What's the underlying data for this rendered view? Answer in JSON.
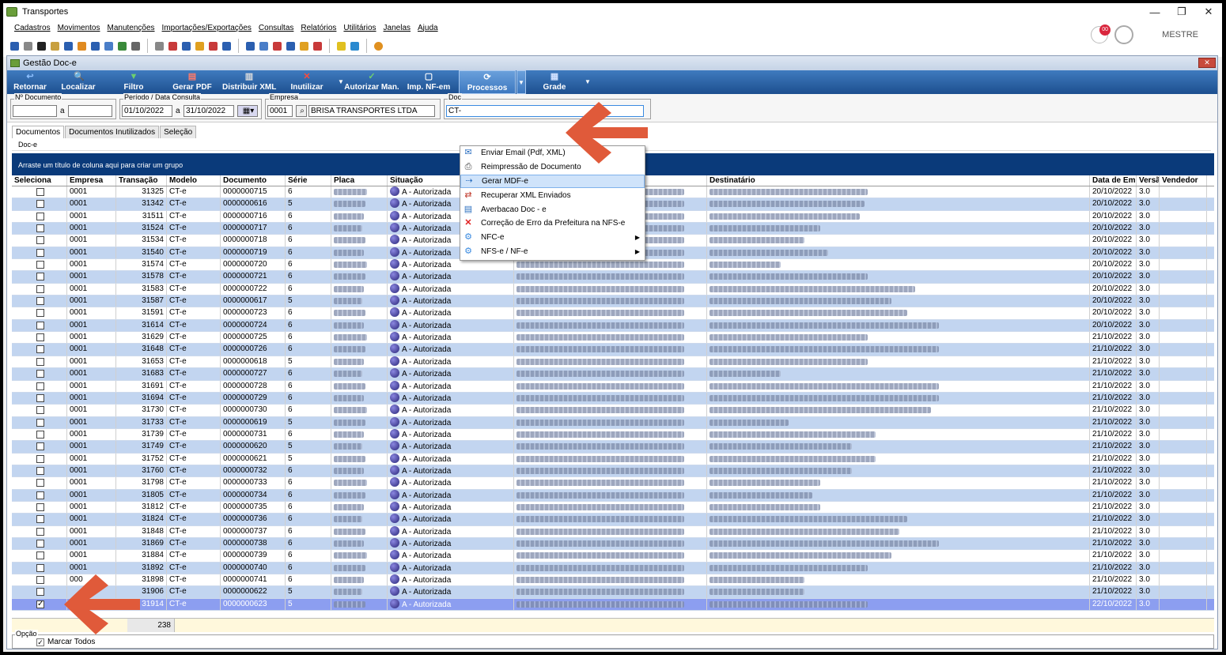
{
  "window": {
    "title": "Transportes",
    "controls": [
      "—",
      "❐",
      "✕"
    ]
  },
  "menu": [
    "Cadastros",
    "Movimentos",
    "Manutenções",
    "Importações/Exportações",
    "Consultas",
    "Relatórios",
    "Utilitários",
    "Janelas",
    "Ajuda"
  ],
  "user": {
    "name": "MESTRE",
    "notification_count": "00"
  },
  "child": {
    "title": "Gestão Doc-e",
    "close": "✕"
  },
  "ribbon": [
    {
      "label": "Retornar",
      "icon": "↩"
    },
    {
      "label": "Localizar",
      "icon": "🔍"
    },
    {
      "label": "Filtro",
      "icon": "▼"
    },
    {
      "label": "Gerar PDF",
      "icon": "▤"
    },
    {
      "label": "Distribuir XML",
      "icon": "▥"
    },
    {
      "label": "Inutilizar",
      "icon": "✕"
    },
    {
      "label": "Autorizar Man.",
      "icon": "✓"
    },
    {
      "label": "Imp. NF-em",
      "icon": "▢"
    },
    {
      "label": "Processos",
      "icon": "⟳"
    },
    {
      "label": "Grade",
      "icon": "▦"
    }
  ],
  "filters": {
    "doc_legend": "Nº Documento",
    "doc_from": "",
    "doc_sep": "a",
    "doc_to": "",
    "period_legend": "Período / Data Consulta",
    "period_from": "01/10/2022",
    "period_sep": "a",
    "period_to": "31/10/2022",
    "empresa_legend": "Empresa",
    "empresa_code": "0001",
    "empresa_name": "BRISA TRANSPORTES LTDA",
    "doc_type_legend": "Doc",
    "doc_type_value": "CT-"
  },
  "tabs": [
    "Documentos",
    "Documentos Inutilizados",
    "Seleção"
  ],
  "sub_tab": "Doc-e",
  "group_panel": "Arraste um título de coluna aqui para criar um grupo",
  "columns": [
    "Seleciona",
    "Empresa",
    "Transação",
    "Modelo",
    "Documento",
    "Série",
    "Placa",
    "Situação",
    "Destinatário",
    "Data de Emiss",
    "Versã",
    "Vendedor"
  ],
  "rows": [
    {
      "empresa": "0001",
      "transacao": "31325",
      "modelo": "CT-e",
      "documento": "0000000715",
      "serie": "6",
      "situacao": "A - Autorizada",
      "data": "20/10/2022",
      "versao": "3.0",
      "checked": false
    },
    {
      "empresa": "0001",
      "transacao": "31342",
      "modelo": "CT-e",
      "documento": "0000000616",
      "serie": "5",
      "situacao": "A - Autorizada",
      "data": "20/10/2022",
      "versao": "3.0",
      "checked": false
    },
    {
      "empresa": "0001",
      "transacao": "31511",
      "modelo": "CT-e",
      "documento": "0000000716",
      "serie": "6",
      "situacao": "A - Autorizada",
      "data": "20/10/2022",
      "versao": "3.0",
      "checked": false
    },
    {
      "empresa": "0001",
      "transacao": "31524",
      "modelo": "CT-e",
      "documento": "0000000717",
      "serie": "6",
      "situacao": "A - Autorizada",
      "data": "20/10/2022",
      "versao": "3.0",
      "checked": false
    },
    {
      "empresa": "0001",
      "transacao": "31534",
      "modelo": "CT-e",
      "documento": "0000000718",
      "serie": "6",
      "situacao": "A - Autorizada",
      "data": "20/10/2022",
      "versao": "3.0",
      "checked": false
    },
    {
      "empresa": "0001",
      "transacao": "31540",
      "modelo": "CT-e",
      "documento": "0000000719",
      "serie": "6",
      "situacao": "A - Autorizada",
      "data": "20/10/2022",
      "versao": "3.0",
      "checked": false
    },
    {
      "empresa": "0001",
      "transacao": "31574",
      "modelo": "CT-e",
      "documento": "0000000720",
      "serie": "6",
      "situacao": "A - Autorizada",
      "data": "20/10/2022",
      "versao": "3.0",
      "checked": false
    },
    {
      "empresa": "0001",
      "transacao": "31578",
      "modelo": "CT-e",
      "documento": "0000000721",
      "serie": "6",
      "situacao": "A - Autorizada",
      "data": "20/10/2022",
      "versao": "3.0",
      "checked": false
    },
    {
      "empresa": "0001",
      "transacao": "31583",
      "modelo": "CT-e",
      "documento": "0000000722",
      "serie": "6",
      "situacao": "A - Autorizada",
      "data": "20/10/2022",
      "versao": "3.0",
      "checked": false
    },
    {
      "empresa": "0001",
      "transacao": "31587",
      "modelo": "CT-e",
      "documento": "0000000617",
      "serie": "5",
      "situacao": "A - Autorizada",
      "data": "20/10/2022",
      "versao": "3.0",
      "checked": false
    },
    {
      "empresa": "0001",
      "transacao": "31591",
      "modelo": "CT-e",
      "documento": "0000000723",
      "serie": "6",
      "situacao": "A - Autorizada",
      "data": "20/10/2022",
      "versao": "3.0",
      "checked": false
    },
    {
      "empresa": "0001",
      "transacao": "31614",
      "modelo": "CT-e",
      "documento": "0000000724",
      "serie": "6",
      "situacao": "A - Autorizada",
      "data": "20/10/2022",
      "versao": "3.0",
      "checked": false
    },
    {
      "empresa": "0001",
      "transacao": "31629",
      "modelo": "CT-e",
      "documento": "0000000725",
      "serie": "6",
      "situacao": "A - Autorizada",
      "data": "21/10/2022",
      "versao": "3.0",
      "checked": false
    },
    {
      "empresa": "0001",
      "transacao": "31648",
      "modelo": "CT-e",
      "documento": "0000000726",
      "serie": "6",
      "situacao": "A - Autorizada",
      "data": "21/10/2022",
      "versao": "3.0",
      "checked": false
    },
    {
      "empresa": "0001",
      "transacao": "31653",
      "modelo": "CT-e",
      "documento": "0000000618",
      "serie": "5",
      "situacao": "A - Autorizada",
      "data": "21/10/2022",
      "versao": "3.0",
      "checked": false
    },
    {
      "empresa": "0001",
      "transacao": "31683",
      "modelo": "CT-e",
      "documento": "0000000727",
      "serie": "6",
      "situacao": "A - Autorizada",
      "data": "21/10/2022",
      "versao": "3.0",
      "checked": false
    },
    {
      "empresa": "0001",
      "transacao": "31691",
      "modelo": "CT-e",
      "documento": "0000000728",
      "serie": "6",
      "situacao": "A - Autorizada",
      "data": "21/10/2022",
      "versao": "3.0",
      "checked": false
    },
    {
      "empresa": "0001",
      "transacao": "31694",
      "modelo": "CT-e",
      "documento": "0000000729",
      "serie": "6",
      "situacao": "A - Autorizada",
      "data": "21/10/2022",
      "versao": "3.0",
      "checked": false
    },
    {
      "empresa": "0001",
      "transacao": "31730",
      "modelo": "CT-e",
      "documento": "0000000730",
      "serie": "6",
      "situacao": "A - Autorizada",
      "data": "21/10/2022",
      "versao": "3.0",
      "checked": false
    },
    {
      "empresa": "0001",
      "transacao": "31733",
      "modelo": "CT-e",
      "documento": "0000000619",
      "serie": "5",
      "situacao": "A - Autorizada",
      "data": "21/10/2022",
      "versao": "3.0",
      "checked": false
    },
    {
      "empresa": "0001",
      "transacao": "31739",
      "modelo": "CT-e",
      "documento": "0000000731",
      "serie": "6",
      "situacao": "A - Autorizada",
      "data": "21/10/2022",
      "versao": "3.0",
      "checked": false
    },
    {
      "empresa": "0001",
      "transacao": "31749",
      "modelo": "CT-e",
      "documento": "0000000620",
      "serie": "5",
      "situacao": "A - Autorizada",
      "data": "21/10/2022",
      "versao": "3.0",
      "checked": false
    },
    {
      "empresa": "0001",
      "transacao": "31752",
      "modelo": "CT-e",
      "documento": "0000000621",
      "serie": "5",
      "situacao": "A - Autorizada",
      "data": "21/10/2022",
      "versao": "3.0",
      "checked": false
    },
    {
      "empresa": "0001",
      "transacao": "31760",
      "modelo": "CT-e",
      "documento": "0000000732",
      "serie": "6",
      "situacao": "A - Autorizada",
      "data": "21/10/2022",
      "versao": "3.0",
      "checked": false
    },
    {
      "empresa": "0001",
      "transacao": "31798",
      "modelo": "CT-e",
      "documento": "0000000733",
      "serie": "6",
      "situacao": "A - Autorizada",
      "data": "21/10/2022",
      "versao": "3.0",
      "checked": false
    },
    {
      "empresa": "0001",
      "transacao": "31805",
      "modelo": "CT-e",
      "documento": "0000000734",
      "serie": "6",
      "situacao": "A - Autorizada",
      "data": "21/10/2022",
      "versao": "3.0",
      "checked": false
    },
    {
      "empresa": "0001",
      "transacao": "31812",
      "modelo": "CT-e",
      "documento": "0000000735",
      "serie": "6",
      "situacao": "A - Autorizada",
      "data": "21/10/2022",
      "versao": "3.0",
      "checked": false
    },
    {
      "empresa": "0001",
      "transacao": "31824",
      "modelo": "CT-e",
      "documento": "0000000736",
      "serie": "6",
      "situacao": "A - Autorizada",
      "data": "21/10/2022",
      "versao": "3.0",
      "checked": false
    },
    {
      "empresa": "0001",
      "transacao": "31848",
      "modelo": "CT-e",
      "documento": "0000000737",
      "serie": "6",
      "situacao": "A - Autorizada",
      "data": "21/10/2022",
      "versao": "3.0",
      "checked": false
    },
    {
      "empresa": "0001",
      "transacao": "31869",
      "modelo": "CT-e",
      "documento": "0000000738",
      "serie": "6",
      "situacao": "A - Autorizada",
      "data": "21/10/2022",
      "versao": "3.0",
      "checked": false
    },
    {
      "empresa": "0001",
      "transacao": "31884",
      "modelo": "CT-e",
      "documento": "0000000739",
      "serie": "6",
      "situacao": "A - Autorizada",
      "data": "21/10/2022",
      "versao": "3.0",
      "checked": false
    },
    {
      "empresa": "0001",
      "transacao": "31892",
      "modelo": "CT-e",
      "documento": "0000000740",
      "serie": "6",
      "situacao": "A - Autorizada",
      "data": "21/10/2022",
      "versao": "3.0",
      "checked": false
    },
    {
      "empresa": "000",
      "transacao": "31898",
      "modelo": "CT-e",
      "documento": "0000000741",
      "serie": "6",
      "situacao": "A - Autorizada",
      "data": "21/10/2022",
      "versao": "3.0",
      "checked": false
    },
    {
      "empresa": "",
      "transacao": "31906",
      "modelo": "CT-e",
      "documento": "0000000622",
      "serie": "5",
      "situacao": "A - Autorizada",
      "data": "21/10/2022",
      "versao": "3.0",
      "checked": false
    },
    {
      "empresa": "",
      "transacao": "31914",
      "modelo": "CT-e",
      "documento": "0000000623",
      "serie": "5",
      "situacao": "A - Autorizada",
      "data": "22/10/2022",
      "versao": "3.0",
      "checked": true
    }
  ],
  "footer": {
    "count": "238"
  },
  "opcao": {
    "legend": "Opção",
    "marcar_todos": "Marcar Todos"
  },
  "processos_menu": [
    {
      "label": "Enviar Email (Pdf, XML)",
      "icon": "✉",
      "submenu": false
    },
    {
      "label": "Reimpressão de Documento",
      "icon": "⎙",
      "submenu": false
    },
    {
      "label": "Gerar MDF-e",
      "icon": "⇢",
      "submenu": false,
      "highlight": true
    },
    {
      "label": "Recuperar XML Enviados",
      "icon": "⇄",
      "submenu": false
    },
    {
      "label": "Averbacao Doc - e",
      "icon": "▤",
      "submenu": false
    },
    {
      "label": "Correção de Erro da Prefeitura na NFS-e",
      "icon": "✕",
      "submenu": false
    },
    {
      "label": "NFC-e",
      "icon": "⚙",
      "submenu": true
    },
    {
      "label": "NFS-e / NF-e",
      "icon": "⚙",
      "submenu": true
    }
  ],
  "colors": {
    "ribbon": "#1d4f8f",
    "row_alt": "#c2d5f0",
    "row_selected": "#8c9ef0",
    "arrow": "#e05a3a"
  }
}
